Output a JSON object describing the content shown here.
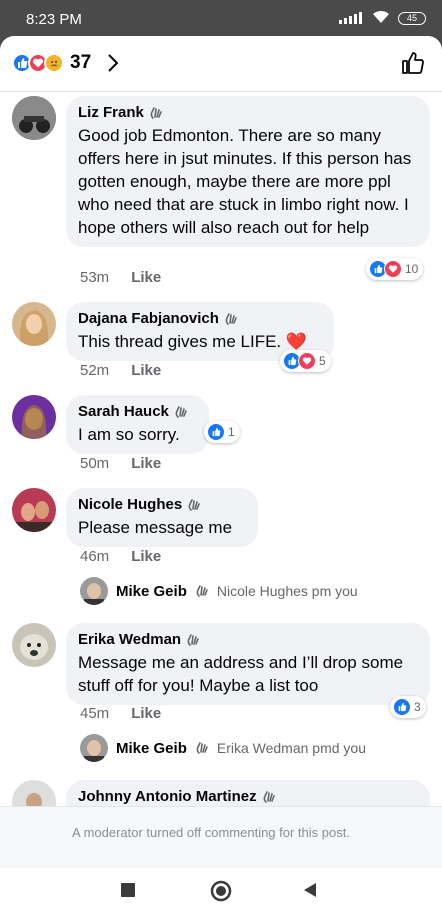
{
  "status": {
    "time": "8:23 PM",
    "battery": "45"
  },
  "header": {
    "reaction_count": "37"
  },
  "comments": [
    {
      "name": "Liz Frank",
      "text": "Good job Edmonton. There are so many offers here in jsut minutes. If this person has gotten enough, maybe there are more ppl who need that are stuck in limbo right now. I hope others will also reach out for help",
      "time": "53m",
      "like_label": "Like",
      "reactions": "10"
    },
    {
      "name": "Dajana Fabjanovich",
      "text": "This thread gives me LIFE. ❤️",
      "time": "52m",
      "like_label": "Like",
      "reactions": "5"
    },
    {
      "name": "Sarah Hauck",
      "text": "I am so sorry.",
      "time": "50m",
      "like_label": "Like",
      "reactions": "1"
    },
    {
      "name": "Nicole Hughes",
      "text": "Please message me",
      "time": "46m",
      "like_label": "Like",
      "reply": {
        "name": "Mike Geib",
        "text": "Nicole Hughes pm you"
      }
    },
    {
      "name": "Erika Wedman",
      "text": "Message me an address and I’ll drop some stuff off for you! Maybe a list too",
      "time": "45m",
      "like_label": "Like",
      "reactions": "3",
      "reply": {
        "name": "Mike Geib",
        "text": "Erika Wedman pmd you"
      }
    },
    {
      "name": "Johnny Antonio Martinez"
    }
  ],
  "footer": {
    "notice": "A moderator turned off commenting for this post."
  },
  "colors": {
    "like": "#1877f2",
    "love": "#f33e58",
    "sad": "#f7b125"
  }
}
